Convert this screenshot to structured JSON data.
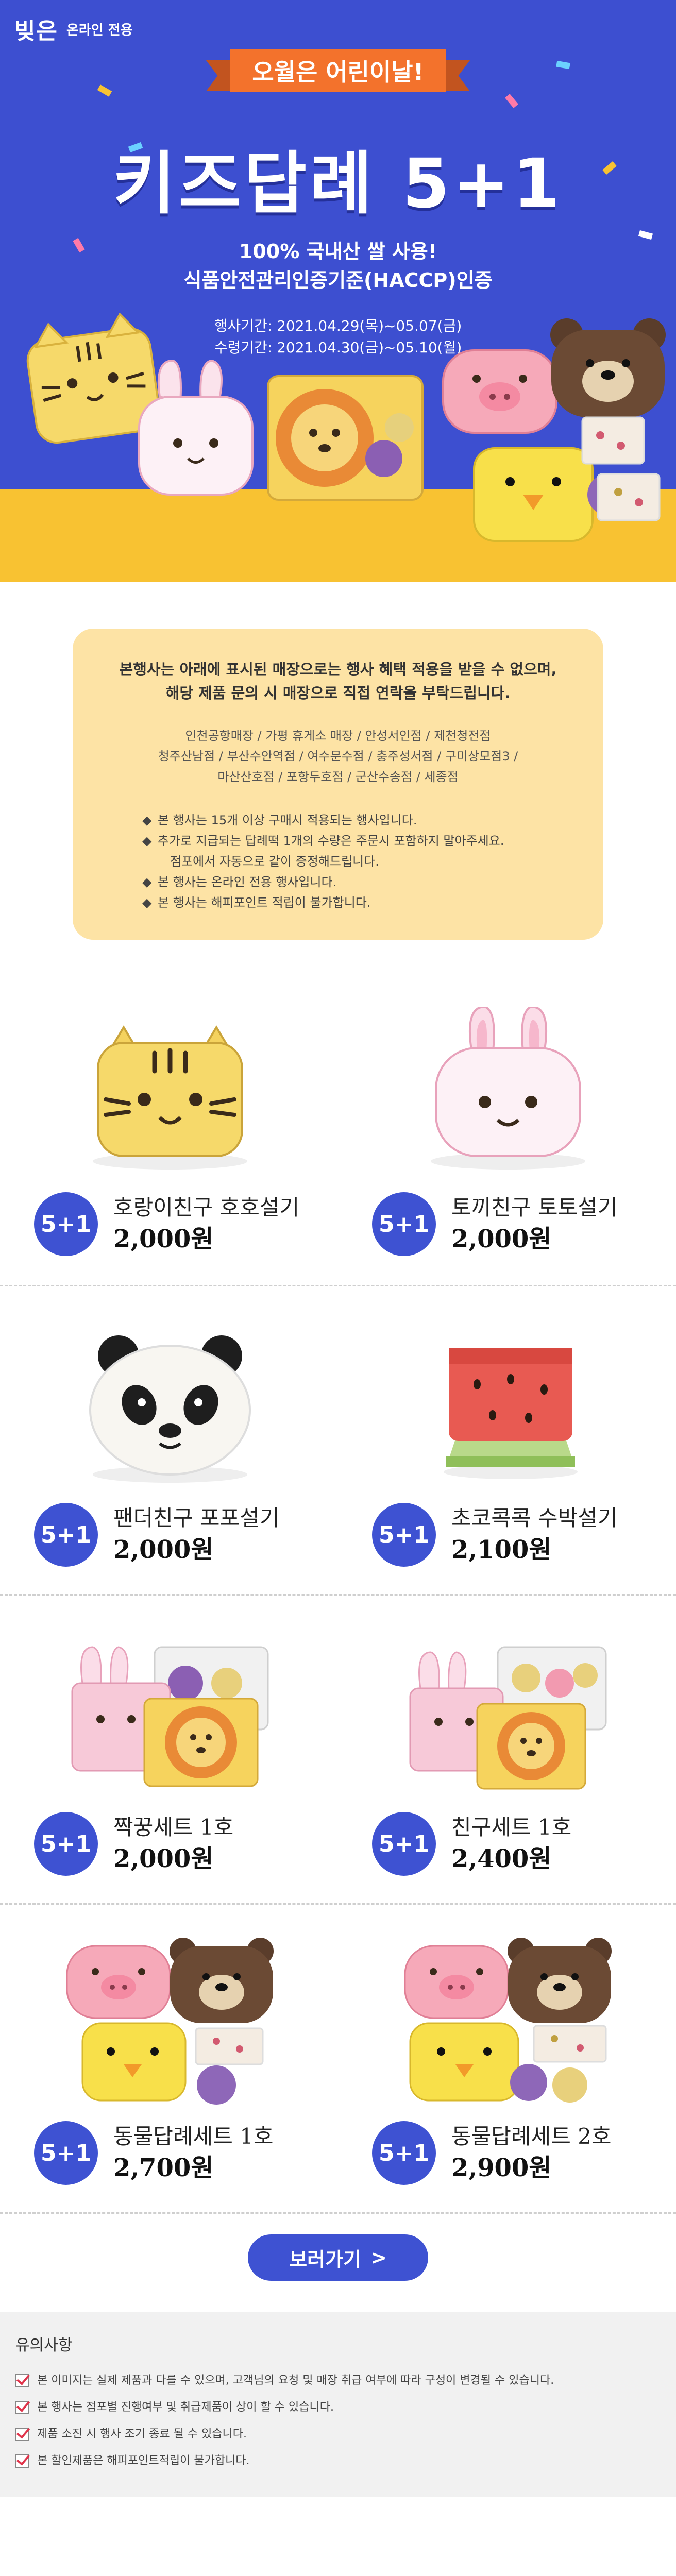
{
  "brand": {
    "logo": "빚은",
    "online_label": "온라인 전용"
  },
  "hero": {
    "ribbon": "오월은 어린이날!",
    "title": "키즈답례 5+1",
    "sub_line1": "100% 국내산 쌀 사용!",
    "sub_line2": "식품안전관리인증기준(HACCP)인증",
    "event_period": "행사기간: 2021.04.29(목)~05.07(금)",
    "pickup_period": "수령기간: 2021.04.30(금)~05.10(월)",
    "colors": {
      "background": "#3d4fd0",
      "floor": "#f8c232",
      "ribbon": "#f3722c"
    }
  },
  "notice": {
    "head_line1": "본행사는 아래에 표시된 매장으로는 행사 혜택 적용을 받을 수 없으며,",
    "head_line2": "해당 제품 문의 시 매장으로 직접 연락을 부탁드립니다.",
    "stores_line1": "인천공항매장 / 가평 휴게소 매장 / 안성서인점 / 제천청전점",
    "stores_line2": "청주산남점 / 부산수안역점 / 여수문수점 / 충주성서점 / 구미상모점3 /",
    "stores_line3": "마산산호점 / 포항두호점 / 군산수송점 / 세종점",
    "bullets": [
      {
        "text": "본 행사는 15개 이상 구매시 적용되는 행사입니다."
      },
      {
        "text": "추가로 지급되는 답례떡 1개의 수량은 주문시 포함하지 말아주세요.",
        "cont": "점포에서 자동으로 같이 증정해드립니다."
      },
      {
        "text": "본 행사는 온라인 전용 행사입니다."
      },
      {
        "text": "본 행사는 해피포인트 적립이 불가합니다."
      }
    ]
  },
  "products": [
    {
      "badge": "5+1",
      "name": "호랑이친구 호호설기",
      "price": "2,000원",
      "image": "tiger-cake"
    },
    {
      "badge": "5+1",
      "name": "토끼친구 토토설기",
      "price": "2,000원",
      "image": "rabbit-cake"
    },
    {
      "badge": "5+1",
      "name": "팬더친구 포포설기",
      "price": "2,000원",
      "image": "panda-cake"
    },
    {
      "badge": "5+1",
      "name": "초코콕콕 수박설기",
      "price": "2,100원",
      "image": "watermelon-cake"
    },
    {
      "badge": "5+1",
      "name": "짝꿍세트 1호",
      "price": "2,000원",
      "image": "pair-set-box"
    },
    {
      "badge": "5+1",
      "name": "친구세트 1호",
      "price": "2,400원",
      "image": "friend-set-box"
    },
    {
      "badge": "5+1",
      "name": "동물답례세트 1호",
      "price": "2,700원",
      "image": "animal-set-box-1"
    },
    {
      "badge": "5+1",
      "name": "동물답례세트 2호",
      "price": "2,900원",
      "image": "animal-set-box-2"
    }
  ],
  "cta": {
    "label": "보러가기",
    "arrow": ">"
  },
  "cautions": {
    "title": "유의사항",
    "items": [
      "본 이미지는 실제 제품과 다를 수 있으며, 고객님의 요청 및 매장 취급 여부에 따라 구성이 변경될 수 있습니다.",
      "본 행사는 점포별 진행여부 및 취급제품이 상이 할 수 있습니다.",
      "제품 소진 시 행사 조기 종료 될 수 있습니다.",
      "본 할인제품은 해피포인트적립이 불가합니다."
    ]
  },
  "accent_color": "#3e52d2"
}
